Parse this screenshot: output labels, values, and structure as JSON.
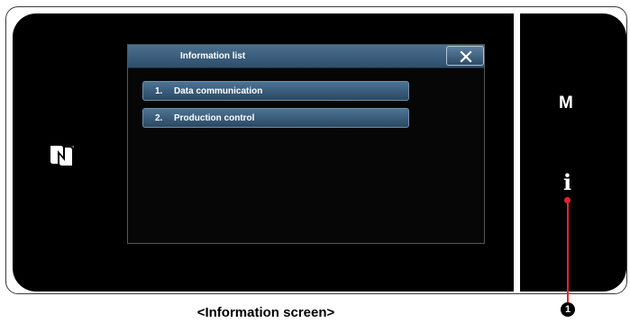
{
  "dialog": {
    "title": "Information list",
    "close_icon": "close-x-icon"
  },
  "list": [
    {
      "number": "1.",
      "label": "Data communication"
    },
    {
      "number": "2.",
      "label": "Production control"
    }
  ],
  "side_keys": {
    "menu": "M",
    "information": "i"
  },
  "nfc_icon": "nfc-n-mark-icon",
  "callout": {
    "marker": "1"
  },
  "caption": "<Information screen>",
  "colors": {
    "accent_blue": "#3d6283",
    "callout_red": "#e8222a",
    "screen_bg": "#000000"
  }
}
